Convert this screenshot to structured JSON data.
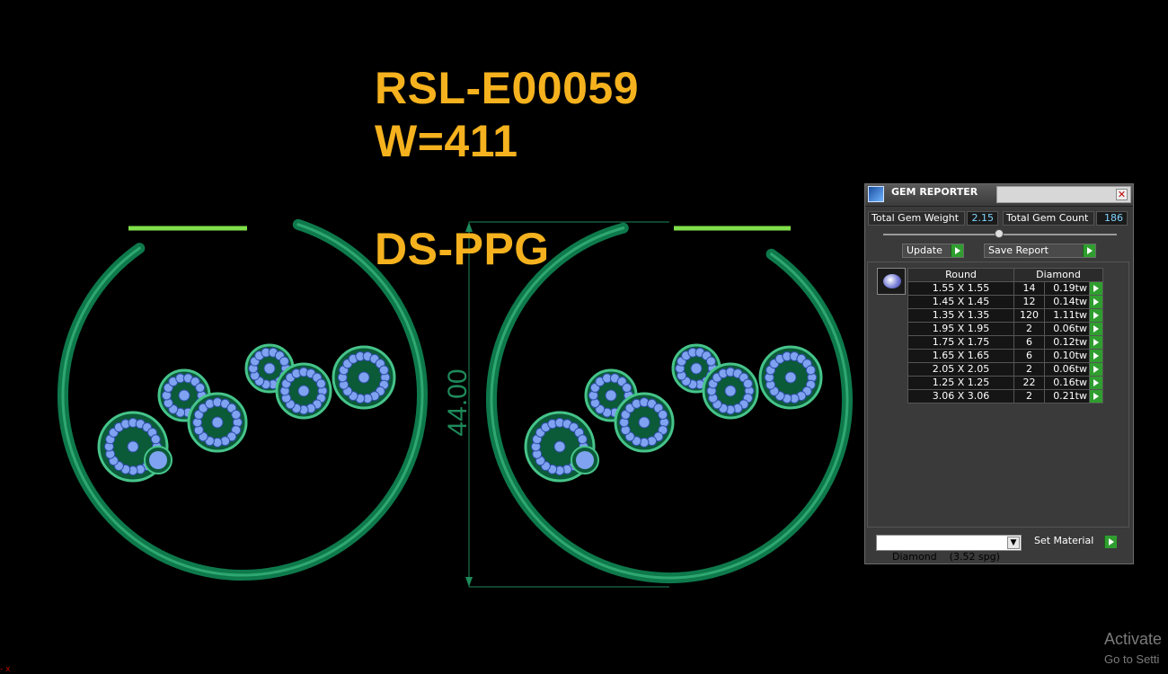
{
  "canvas": {
    "part_code": "RSL-E00059",
    "weight_label": "W=411",
    "finish_code": "DS-PPG",
    "dimension_label": "44.00",
    "colors": {
      "background": "#000000",
      "annotation_text": "#F5B21E",
      "metal": "#0E7A4C",
      "metal_highlight": "#46C48A",
      "post": "#7FE04A",
      "stone": "#7FA3F0",
      "dimension_line": "#1E8A5A"
    }
  },
  "gem_reporter": {
    "title": "GEM REPORTER",
    "close_icon": "close-icon",
    "total_gem_weight_label": "Total Gem Weight",
    "total_gem_weight_value": "2.15",
    "total_gem_count_label": "Total Gem Count",
    "total_gem_count_value": "186",
    "update_label": "Update",
    "save_report_label": "Save Report",
    "columns": {
      "shape": "Round",
      "material": "Diamond"
    },
    "rows": [
      {
        "size": "1.55 X 1.55",
        "count": "14",
        "weight": "0.19tw"
      },
      {
        "size": "1.45 X 1.45",
        "count": "12",
        "weight": "0.14tw"
      },
      {
        "size": "1.35 X 1.35",
        "count": "120",
        "weight": "1.11tw"
      },
      {
        "size": "1.95 X 1.95",
        "count": "2",
        "weight": "0.06tw"
      },
      {
        "size": "1.75 X 1.75",
        "count": "6",
        "weight": "0.12tw"
      },
      {
        "size": "1.65 X 1.65",
        "count": "6",
        "weight": "0.10tw"
      },
      {
        "size": "2.05 X 2.05",
        "count": "2",
        "weight": "0.06tw"
      },
      {
        "size": "1.25 X 1.25",
        "count": "22",
        "weight": "0.16tw"
      },
      {
        "size": "3.06 X 3.06",
        "count": "2",
        "weight": "0.21tw"
      }
    ],
    "material_select_value": "Diamond    (3.52 spg)",
    "set_material_label": "Set Material"
  },
  "watermark": {
    "title": "Activate",
    "subtitle": "Go to Setti"
  },
  "corner_mark": "- x"
}
